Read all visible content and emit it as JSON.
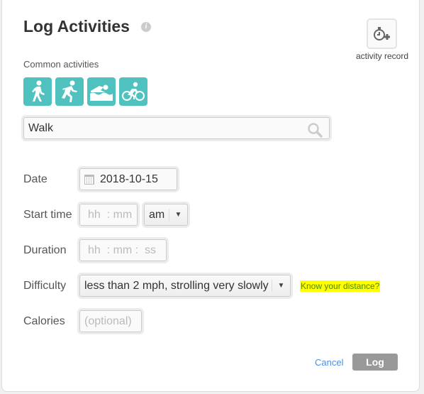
{
  "header": {
    "title": "Log Activities",
    "info_icon": "info-icon"
  },
  "activity_record": {
    "label": "activity record",
    "icon": "stopwatch-plus-icon"
  },
  "common": {
    "label": "Common activities",
    "items": [
      {
        "name": "walk",
        "icon": "walking-icon"
      },
      {
        "name": "run",
        "icon": "running-icon"
      },
      {
        "name": "swim",
        "icon": "swimming-icon"
      },
      {
        "name": "bike",
        "icon": "cycling-icon"
      }
    ],
    "color": "#4fc1bf"
  },
  "search": {
    "value": "Walk",
    "icon": "search-icon"
  },
  "form": {
    "date": {
      "label": "Date",
      "value": "2018-10-15"
    },
    "start_time": {
      "label": "Start time",
      "hh": "hh",
      "sep": ":",
      "mm": "mm",
      "ampm": "am"
    },
    "duration": {
      "label": "Duration",
      "hh": "hh",
      "sep1": ":",
      "mm": "mm",
      "sep2": ":",
      "ss": "ss"
    },
    "difficulty": {
      "label": "Difficulty",
      "value": "less than 2 mph, strolling very slowly",
      "link": "Know your distance?"
    },
    "calories": {
      "label": "Calories",
      "placeholder": "(optional)"
    }
  },
  "actions": {
    "cancel": "Cancel",
    "log": "Log"
  }
}
